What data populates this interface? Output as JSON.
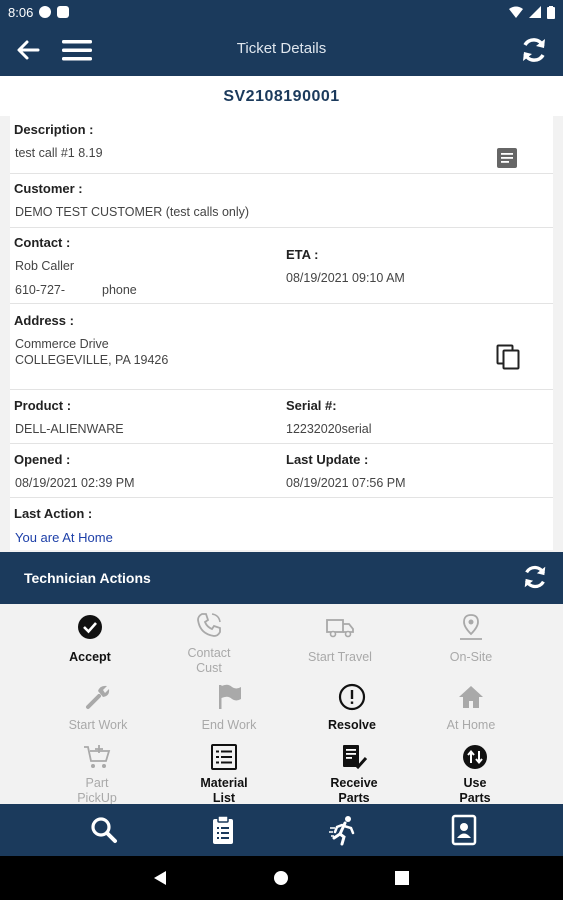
{
  "status_bar": {
    "time": "8:06"
  },
  "app_bar": {
    "title": "Ticket Details"
  },
  "ticket": {
    "number": "SV2108190001",
    "description_label": "Description :",
    "description": "test call #1  8.19",
    "customer_label": "Customer :",
    "customer": "DEMO TEST CUSTOMER (test calls only)",
    "contact_label": "Contact :",
    "contact_name": "Rob Caller",
    "contact_phone": "610-727-",
    "contact_phone_type": "phone",
    "eta_label": "ETA :",
    "eta": "08/19/2021 09:10 AM",
    "address_label": "Address :",
    "address_line1": "Commerce Drive",
    "address_line2": "COLLEGEVILLE, PA  19426",
    "product_label": "Product :",
    "product": "DELL-ALIENWARE",
    "serial_label": "Serial #:",
    "serial": "12232020serial",
    "opened_label": "Opened :",
    "opened": "08/19/2021 02:39 PM",
    "last_update_label": "Last Update :",
    "last_update": "08/19/2021 07:56 PM",
    "last_action_label": "Last Action :",
    "last_action": "You are At Home"
  },
  "tech_actions": {
    "title": "Technician Actions",
    "items": [
      {
        "label": "Accept",
        "icon": "check-circle-icon",
        "enabled": true
      },
      {
        "label": "Contact\nCust",
        "icon": "phone-icon",
        "enabled": false
      },
      {
        "label": "Start Travel",
        "icon": "truck-icon",
        "enabled": false
      },
      {
        "label": "On-Site",
        "icon": "location-pin-icon",
        "enabled": false
      },
      {
        "label": "Start Work",
        "icon": "wrench-icon",
        "enabled": false
      },
      {
        "label": "End Work",
        "icon": "flag-icon",
        "enabled": false
      },
      {
        "label": "Resolve",
        "icon": "alert-circle-icon",
        "enabled": true
      },
      {
        "label": "At Home",
        "icon": "home-icon",
        "enabled": false
      },
      {
        "label": "Part\nPickUp",
        "icon": "cart-add-icon",
        "enabled": false
      },
      {
        "label": "Material\nList",
        "icon": "list-icon",
        "enabled": true
      },
      {
        "label": "Receive\nParts",
        "icon": "checklist-icon",
        "enabled": true
      },
      {
        "label": "Use\nParts",
        "icon": "swap-circle-icon",
        "enabled": true
      }
    ]
  },
  "bottom_nav": [
    "search-icon",
    "clipboard-icon",
    "running-person-icon",
    "contact-card-icon"
  ],
  "colors": {
    "primary": "#1b3a5c",
    "link": "#1d3fa8",
    "disabled": "#a9a9a9"
  }
}
